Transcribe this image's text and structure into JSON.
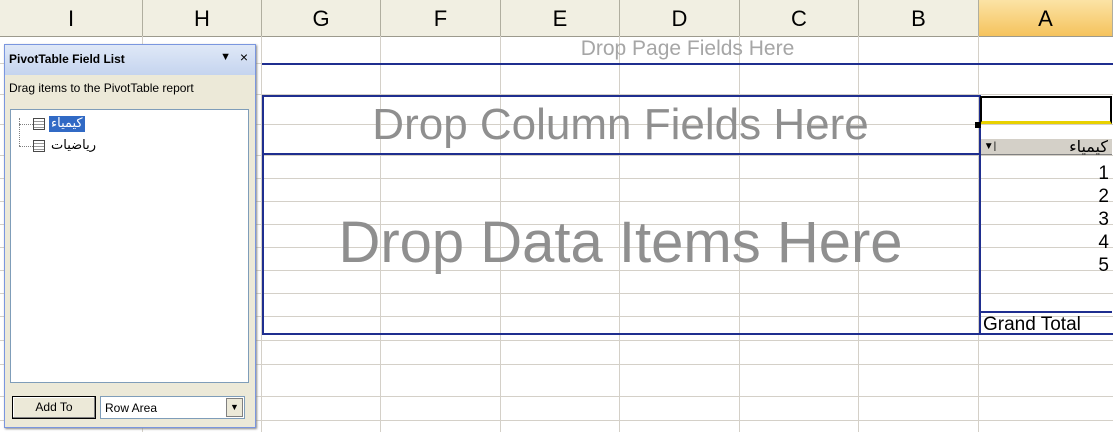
{
  "columns": [
    {
      "name": "I"
    },
    {
      "name": "H"
    },
    {
      "name": "G"
    },
    {
      "name": "F"
    },
    {
      "name": "E"
    },
    {
      "name": "D"
    },
    {
      "name": "C"
    },
    {
      "name": "B"
    },
    {
      "name": "A"
    }
  ],
  "pivot": {
    "page_drop": "Drop Page Fields Here",
    "column_drop": "Drop Column Fields Here",
    "data_drop": "Drop Data Items Here",
    "row_field": "كيمياء",
    "row_items": [
      "1",
      "2",
      "3",
      "4",
      "5"
    ],
    "grand_total": "Grand Total"
  },
  "field_list": {
    "title": "PivotTable Field List",
    "instructions": "Drag items to the PivotTable report",
    "fields": [
      "كيمياء",
      "رياضيات"
    ],
    "add_to_label": "Add To",
    "area_value": "Row Area",
    "menu_icon": "▼",
    "close_icon": "×"
  },
  "colors": {
    "pivot_border": "#1f2e8f",
    "selection": "#316ac5"
  }
}
